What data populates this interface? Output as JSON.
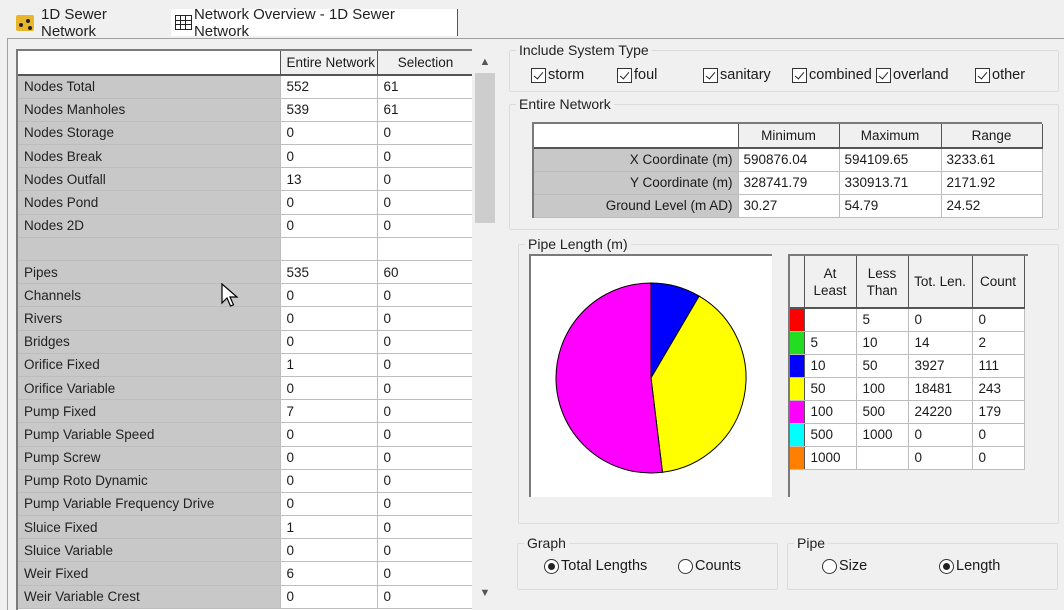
{
  "tabs": [
    {
      "label": "1D Sewer Network",
      "icon": "network-icon",
      "active": false
    },
    {
      "label": "Network Overview - 1D Sewer Network",
      "icon": "grid-icon",
      "active": true
    }
  ],
  "summary_table": {
    "columns": [
      "",
      "Entire Network",
      "Selection"
    ],
    "rows": [
      {
        "label": "Nodes Total",
        "entire": "552",
        "selection": "61"
      },
      {
        "label": "Nodes Manholes",
        "entire": "539",
        "selection": "61"
      },
      {
        "label": "Nodes Storage",
        "entire": "0",
        "selection": "0"
      },
      {
        "label": "Nodes Break",
        "entire": "0",
        "selection": "0"
      },
      {
        "label": "Nodes Outfall",
        "entire": "13",
        "selection": "0"
      },
      {
        "label": "Nodes Pond",
        "entire": "0",
        "selection": "0"
      },
      {
        "label": "Nodes 2D",
        "entire": "0",
        "selection": "0"
      },
      {
        "label": "",
        "entire": "",
        "selection": ""
      },
      {
        "label": "Pipes",
        "entire": "535",
        "selection": "60"
      },
      {
        "label": "Channels",
        "entire": "0",
        "selection": "0"
      },
      {
        "label": "Rivers",
        "entire": "0",
        "selection": "0"
      },
      {
        "label": "Bridges",
        "entire": "0",
        "selection": "0"
      },
      {
        "label": "Orifice Fixed",
        "entire": "1",
        "selection": "0"
      },
      {
        "label": "Orifice Variable",
        "entire": "0",
        "selection": "0"
      },
      {
        "label": "Pump Fixed",
        "entire": "7",
        "selection": "0"
      },
      {
        "label": "Pump Variable Speed",
        "entire": "0",
        "selection": "0"
      },
      {
        "label": "Pump Screw",
        "entire": "0",
        "selection": "0"
      },
      {
        "label": "Pump Roto Dynamic",
        "entire": "0",
        "selection": "0"
      },
      {
        "label": "Pump Variable Frequency Drive",
        "entire": "0",
        "selection": "0"
      },
      {
        "label": "Sluice Fixed",
        "entire": "1",
        "selection": "0"
      },
      {
        "label": "Sluice Variable",
        "entire": "0",
        "selection": "0"
      },
      {
        "label": "Weir Fixed",
        "entire": "6",
        "selection": "0"
      },
      {
        "label": "Weir Variable Crest",
        "entire": "0",
        "selection": "0"
      }
    ]
  },
  "scrollbar": {
    "up_glyph": "^",
    "down_glyph": "v"
  },
  "system_type": {
    "title": "Include System Type",
    "options": [
      {
        "label": "storm",
        "checked": true
      },
      {
        "label": "foul",
        "checked": true
      },
      {
        "label": "sanitary",
        "checked": true
      },
      {
        "label": "combined",
        "checked": true
      },
      {
        "label": "overland",
        "checked": true
      },
      {
        "label": "other",
        "checked": true
      }
    ]
  },
  "entire_network": {
    "title": "Entire Network",
    "columns": [
      "",
      "Minimum",
      "Maximum",
      "Range"
    ],
    "rows": [
      {
        "label": "X Coordinate (m)",
        "min": "590876.04",
        "max": "594109.65",
        "range": "3233.61"
      },
      {
        "label": "Y Coordinate (m)",
        "min": "328741.79",
        "max": "330913.71",
        "range": "2171.92"
      },
      {
        "label": "Ground Level (m AD)",
        "min": "30.27",
        "max": "54.79",
        "range": "24.52"
      }
    ]
  },
  "pipe_length": {
    "title": "Pipe Length (m)",
    "columns": [
      "",
      "At Least",
      "Less Than",
      "Tot. Len.",
      "Count"
    ],
    "bins": [
      {
        "color": "#ff0000",
        "at_least": "",
        "less_than": "5",
        "total": "0",
        "count": "0"
      },
      {
        "color": "#22dd22",
        "at_least": "5",
        "less_than": "10",
        "total": "14",
        "count": "2"
      },
      {
        "color": "#0000ff",
        "at_least": "10",
        "less_than": "50",
        "total": "3927",
        "count": "111"
      },
      {
        "color": "#ffff00",
        "at_least": "50",
        "less_than": "100",
        "total": "18481",
        "count": "243"
      },
      {
        "color": "#ff00ff",
        "at_least": "100",
        "less_than": "500",
        "total": "24220",
        "count": "179"
      },
      {
        "color": "#00ffff",
        "at_least": "500",
        "less_than": "1000",
        "total": "0",
        "count": "0"
      },
      {
        "color": "#ff8000",
        "at_least": "1000",
        "less_than": "",
        "total": "0",
        "count": "0"
      }
    ]
  },
  "chart_data": {
    "type": "pie",
    "title": "Pipe Length (m)",
    "categories": [
      "<5",
      "5-10",
      "10-50",
      "50-100",
      "100-500",
      "500-1000",
      ">=1000"
    ],
    "values": [
      0,
      14,
      3927,
      18481,
      24220,
      0,
      0
    ],
    "colors": [
      "#ff0000",
      "#22dd22",
      "#0000ff",
      "#ffff00",
      "#ff00ff",
      "#00ffff",
      "#ff8000"
    ],
    "legend": "none"
  },
  "graph_options": {
    "title": "Graph",
    "options": [
      {
        "label": "Total Lengths",
        "selected": true
      },
      {
        "label": "Counts",
        "selected": false
      }
    ]
  },
  "pipe_options": {
    "title": "Pipe",
    "options": [
      {
        "label": "Size",
        "selected": false
      },
      {
        "label": "Length",
        "selected": true
      }
    ]
  }
}
